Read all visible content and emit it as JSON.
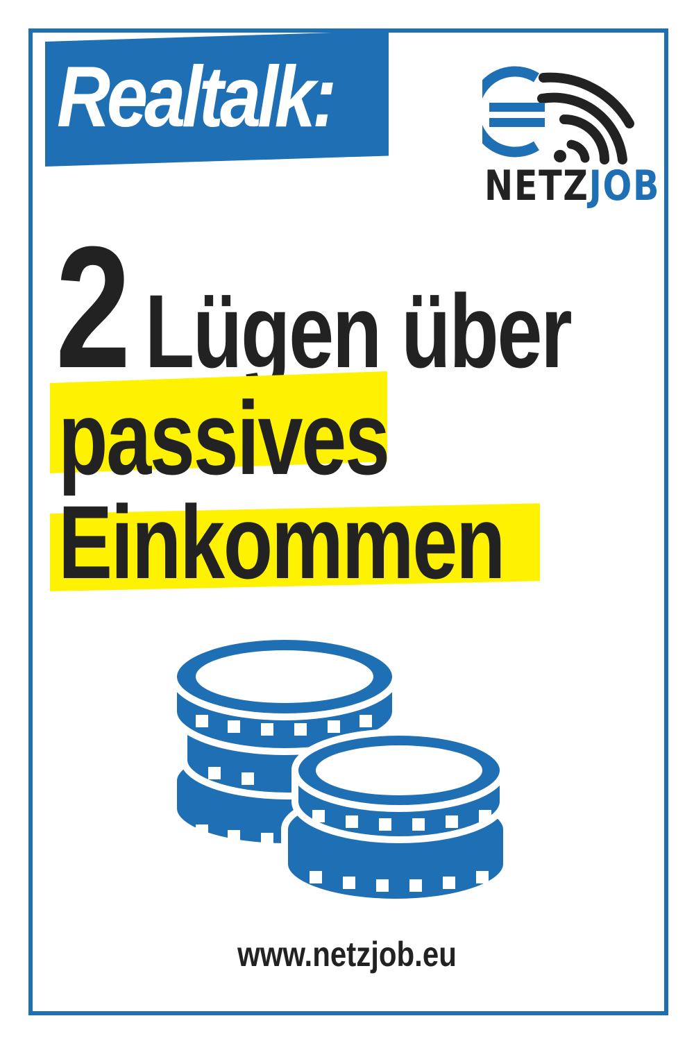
{
  "header": {
    "tag": "Realtalk:"
  },
  "brand": {
    "name_part1": "NETZ",
    "name_part2": "JOB",
    "logo_icon": "euro-wifi-icon"
  },
  "headline": {
    "number": "2",
    "line1": "Lügen über",
    "line2": "passives",
    "line3": "Einkommen"
  },
  "illustration": {
    "icon": "coins-stack-icon"
  },
  "footer": {
    "url": "www.netzjob.eu"
  },
  "colors": {
    "brand_blue": "#1f6fb5",
    "highlight_yellow": "#fff200",
    "text_dark": "#222222",
    "background": "#ffffff"
  }
}
